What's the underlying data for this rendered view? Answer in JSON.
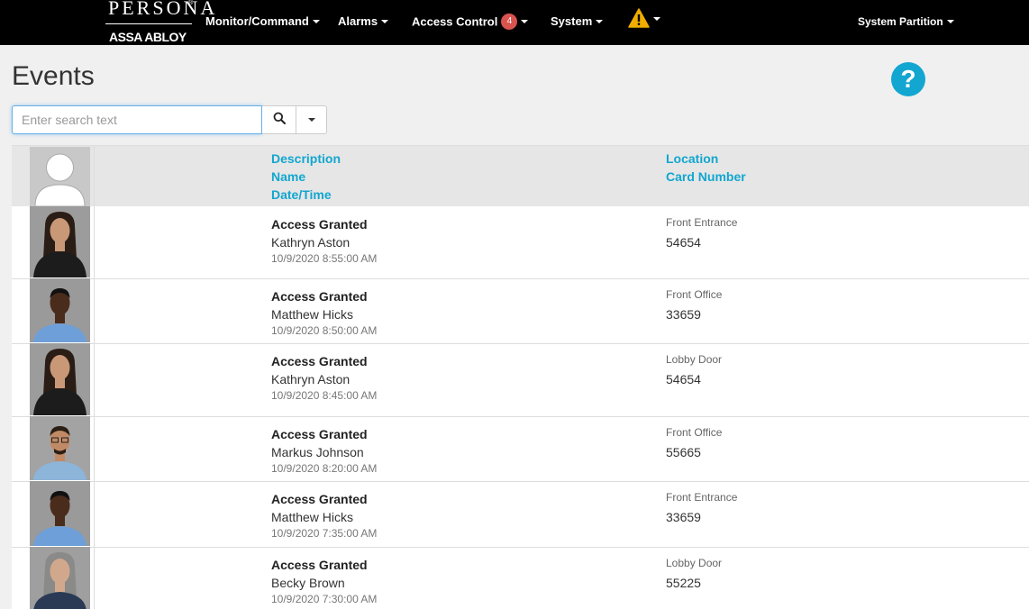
{
  "brand": {
    "top": "PERSONA",
    "trademark": "®",
    "bottom": "ASSA ABLOY"
  },
  "nav": {
    "monitor": "Monitor/Command",
    "alarms": "Alarms",
    "access_control": "Access Control",
    "access_control_badge": "4",
    "system": "System",
    "partition": "System Partition",
    "warning_icon": "warning-triangle-icon"
  },
  "page": {
    "title": "Events",
    "help_glyph": "?"
  },
  "search": {
    "placeholder": "Enter search text",
    "value": ""
  },
  "table": {
    "headers": {
      "description": "Description",
      "name": "Name",
      "datetime": "Date/Time",
      "location": "Location",
      "card_number": "Card Number"
    },
    "rows": [
      {
        "description": "Access Granted",
        "name": "Kathryn Aston",
        "datetime": "10/9/2020 8:55:00 AM",
        "location": "Front Entrance",
        "card": "54654",
        "photo": "woman-dark-hair"
      },
      {
        "description": "Access Granted",
        "name": "Matthew Hicks",
        "datetime": "10/9/2020 8:50:00 AM",
        "location": "Front Office",
        "card": "33659",
        "photo": "man-blue-shirt"
      },
      {
        "description": "Access Granted",
        "name": "Kathryn Aston",
        "datetime": "10/9/2020 8:45:00 AM",
        "location": "Lobby Door",
        "card": "54654",
        "photo": "woman-dark-hair"
      },
      {
        "description": "Access Granted",
        "name": "Markus Johnson",
        "datetime": "10/9/2020 8:20:00 AM",
        "location": "Front Office",
        "card": "55665",
        "photo": "man-glasses"
      },
      {
        "description": "Access Granted",
        "name": "Matthew Hicks",
        "datetime": "10/9/2020 7:35:00 AM",
        "location": "Front Entrance",
        "card": "33659",
        "photo": "man-blue-shirt"
      },
      {
        "description": "Access Granted",
        "name": "Becky Brown",
        "datetime": "10/9/2020 7:30:00 AM",
        "location": "Lobby Door",
        "card": "55225",
        "photo": "woman-gray-hair"
      }
    ]
  },
  "colors": {
    "navbar": "#000000",
    "accent": "#12a6d0",
    "badge": "#d9534f",
    "warning": "#f0ad00"
  }
}
